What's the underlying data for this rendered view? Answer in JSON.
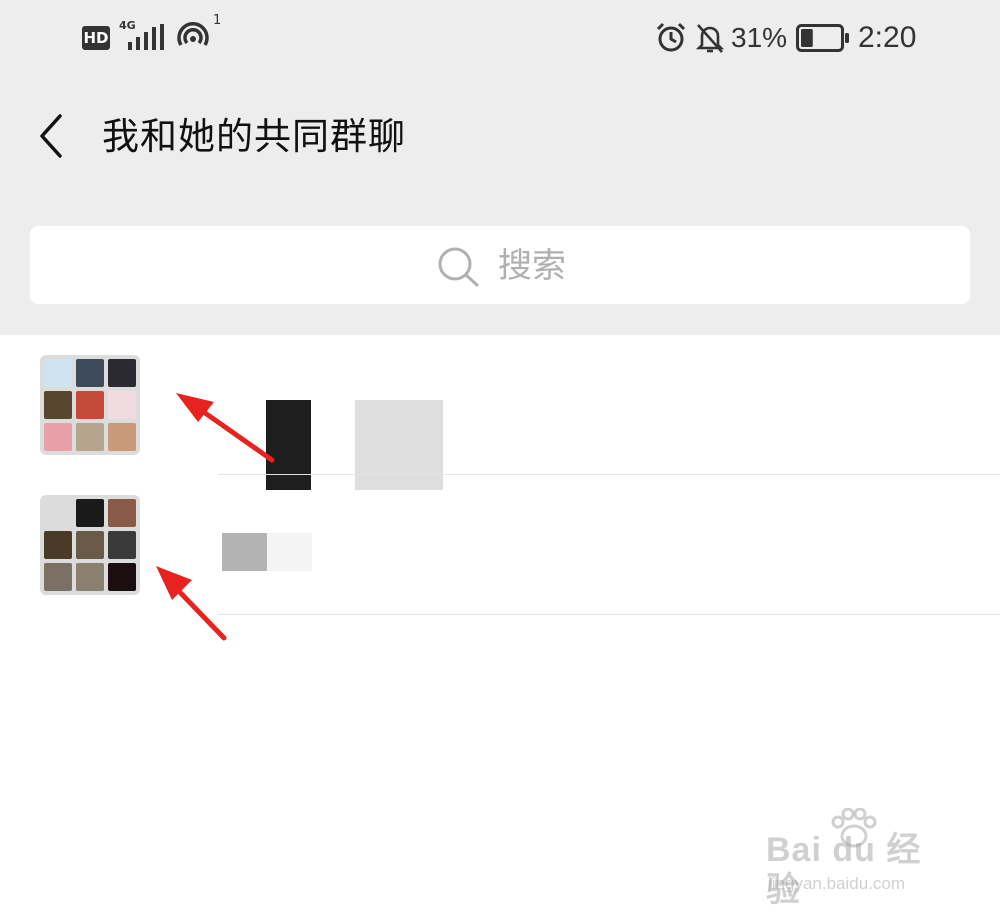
{
  "status_bar": {
    "hd_badge": "HD",
    "network_type": "4G",
    "wifi_count": "1",
    "battery_percent": "31%",
    "battery_level": 0.31,
    "time": "2:20"
  },
  "header": {
    "title": "我和她的共同群聊"
  },
  "search": {
    "placeholder": "搜索"
  },
  "group_list": [
    {
      "avatar_tiles": [
        "#cfe4f0",
        "#3d4a5c",
        "#2a2a30",
        "#5a4630",
        "#c44b3a",
        "#f0dce0",
        "#e8a0a8",
        "#b7a48c",
        "#c99a7a"
      ]
    },
    {
      "avatar_tiles": [
        "#dcdcdc",
        "#1a1a1a",
        "#8a5a48",
        "#4a3a28",
        "#6a5a48",
        "#3a3a3a",
        "#7a7064",
        "#8a8070",
        "#1a0e10"
      ]
    }
  ],
  "annotation": {
    "arrow_color": "#e8231f"
  },
  "watermark": {
    "logo": "Bai du 经验",
    "url": "jingyan.baidu.com"
  },
  "colors": {
    "header_bg": "#ededed",
    "list_bg": "#ffffff",
    "title_text": "#111111",
    "placeholder_text": "#b0b0b0"
  }
}
